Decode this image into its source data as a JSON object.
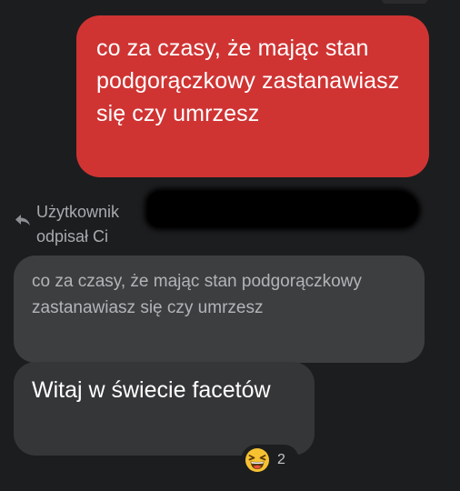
{
  "sent_message": {
    "text": "co za czasy, że mając stan podgorączkowy zastanawiasz się czy umrzesz"
  },
  "reply_header": {
    "line1": "Użytkownik",
    "line2": "odpisał Ci",
    "icon": "reply-arrow-icon"
  },
  "quoted_message": {
    "text": "co za czasy, że mając stan podgorączkowy zastanawiasz się czy umrzesz"
  },
  "received_message": {
    "text": "Witaj w świecie facetów"
  },
  "reaction": {
    "emoji": "laughing-face-icon",
    "count": "2"
  },
  "colors": {
    "background": "#1c1d1f",
    "sent_bubble": "#cf3433",
    "quoted_bubble": "#3d3e40",
    "received_bubble": "#353638",
    "muted_text": "#a9aaad"
  }
}
